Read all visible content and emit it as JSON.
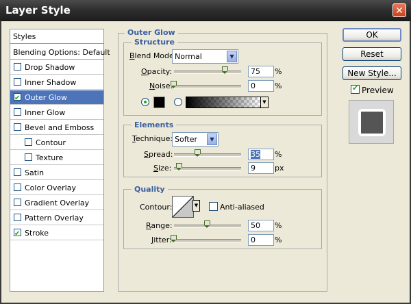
{
  "window": {
    "title": "Layer Style",
    "close_glyph": "✕"
  },
  "styles_list": {
    "header": "Styles",
    "blending": "Blending Options: Default",
    "items": [
      {
        "label": "Drop Shadow",
        "checked": false
      },
      {
        "label": "Inner Shadow",
        "checked": false
      },
      {
        "label": "Outer Glow",
        "checked": true,
        "selected": true
      },
      {
        "label": "Inner Glow",
        "checked": false
      },
      {
        "label": "Bevel and Emboss",
        "checked": false
      },
      {
        "label": "Contour",
        "checked": false,
        "indent": true
      },
      {
        "label": "Texture",
        "checked": false,
        "indent": true
      },
      {
        "label": "Satin",
        "checked": false
      },
      {
        "label": "Color Overlay",
        "checked": false
      },
      {
        "label": "Gradient Overlay",
        "checked": false
      },
      {
        "label": "Pattern Overlay",
        "checked": false
      },
      {
        "label": "Stroke",
        "checked": true
      }
    ]
  },
  "panel": {
    "title": "Outer Glow",
    "structure": {
      "title": "Structure",
      "blend_mode_label": "Blend Mode:",
      "blend_mode_value": "Normal",
      "opacity_label": "Opacity:",
      "opacity_value": "75",
      "noise_label": "Noise:",
      "noise_value": "0",
      "unit": "%"
    },
    "elements": {
      "title": "Elements",
      "technique_label": "Technique:",
      "technique_value": "Softer",
      "spread_label": "Spread:",
      "spread_value": "35",
      "spread_unit": "%",
      "size_label": "Size:",
      "size_value": "9",
      "size_unit": "px"
    },
    "quality": {
      "title": "Quality",
      "contour_label": "Contour:",
      "antialiased_label": "Anti-aliased",
      "range_label": "Range:",
      "range_value": "50",
      "jitter_label": "Jitter:",
      "jitter_value": "0",
      "unit": "%"
    }
  },
  "buttons": {
    "ok": "OK",
    "reset": "Reset",
    "new_style": "New Style...",
    "preview": "Preview"
  },
  "colors": {
    "selected": "#4d73b8",
    "legend": "#3a5f9f",
    "glow_color": "#000000"
  }
}
